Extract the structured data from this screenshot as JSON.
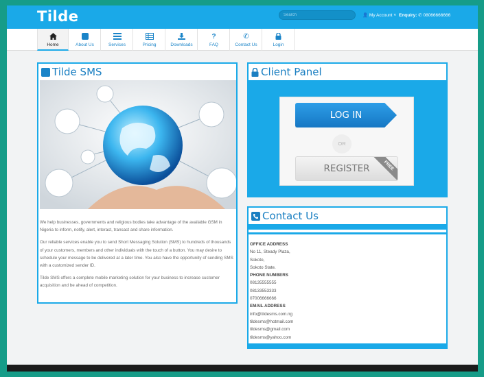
{
  "header": {
    "logo": "Tilde",
    "search_placeholder": "Search",
    "account": "My Account",
    "enquiry_label": "Enquiry:",
    "enquiry_phone": "08066666666"
  },
  "nav": [
    {
      "label": "Home",
      "icon": "home-icon"
    },
    {
      "label": "About Us",
      "icon": "square-icon"
    },
    {
      "label": "Services",
      "icon": "list-icon"
    },
    {
      "label": "Pricing",
      "icon": "table-icon"
    },
    {
      "label": "Downloads",
      "icon": "download-icon"
    },
    {
      "label": "FAQ",
      "icon": "question-icon"
    },
    {
      "label": "Contact Us",
      "icon": "phone-icon"
    },
    {
      "label": "Login",
      "icon": "lock-icon"
    }
  ],
  "tilde_panel": {
    "title": "Tilde SMS",
    "paragraphs": [
      "We help businesses, governments and religious bodies take advantage of the available GSM in Nigeria to inform, notify, alert, interact, transact and share information.",
      "Our reliable services enable you to send Short Messaging Solution (SMS) to hundreds of thousands of your customers, members and other individuals with the touch of a button. You may desire to schedule your message to be delivered at a later time. You also have the opportunity of sending SMS with a customized sender ID.",
      "Tilde SMS offers a complete mobile marketing solution for your business to increase customer acquisition and be ahead of competition."
    ]
  },
  "client_panel": {
    "title": "Client Panel",
    "login_label": "LOG IN",
    "or_label": "OR",
    "register_label": "REGISTER",
    "free_label": "FREE"
  },
  "contact_panel": {
    "title": "Contact Us",
    "office_head": "OFFICE ADDRESS",
    "address": [
      "No 11, Steady Plaza,",
      "Sokoto,",
      "Sokoto State."
    ],
    "phone_head": "PHONE NUMBERS",
    "phones": [
      "08135555555",
      "08133553333",
      "07006666666"
    ],
    "email_head": "EMAIL ADDRESS",
    "emails": [
      "info@tildesms.com.ng",
      "tildesms@hotmail.com",
      "tildesms@gmail.com",
      "tildesms@yahoo.com"
    ]
  },
  "colors": {
    "accent": "#1aa9e8",
    "frame": "#169c88",
    "link": "#1a84c8"
  }
}
